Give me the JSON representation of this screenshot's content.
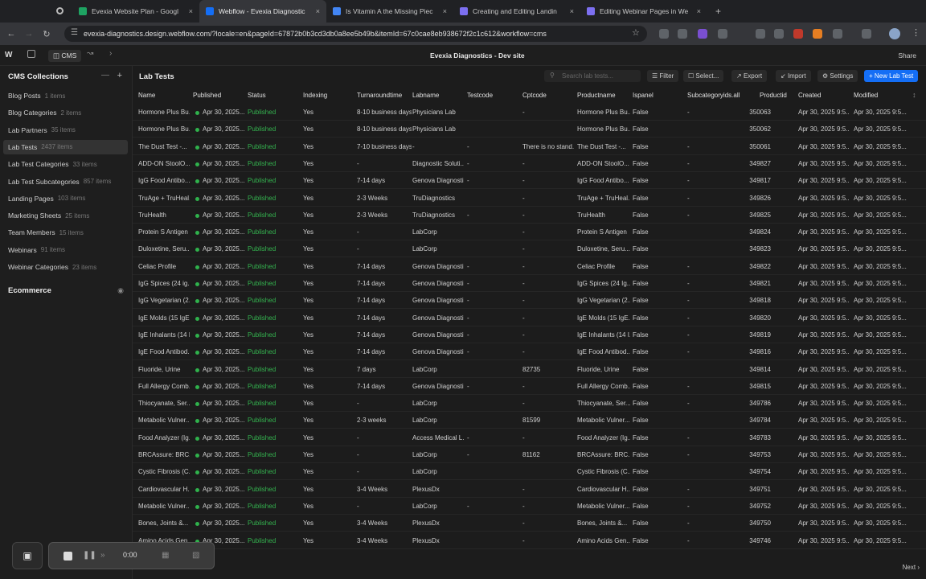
{
  "browser": {
    "tabs": [
      {
        "title": "Evexia Website Plan - Googl",
        "color": "#1ea362",
        "active": false
      },
      {
        "title": "Webflow - Evexia Diagnostic",
        "color": "#146ef5",
        "active": true
      },
      {
        "title": "Is Vitamin A the Missing Piec",
        "color": "#4285f4",
        "active": false
      },
      {
        "title": "Creating and Editing Landin",
        "color": "#7c6ff0",
        "active": false
      },
      {
        "title": "Editing Webinar Pages in We",
        "color": "#7c6ff0",
        "active": false
      }
    ],
    "new_tab": "+",
    "url": "evexia-diagnostics.design.webflow.com/?locale=en&pageId=67872b0b3cd3db0a8ee5b49b&itemId=67c0cae8eb938672f2c1c612&workflow=cms"
  },
  "webflow": {
    "cms_label": "CMS",
    "site_title": "Evexia Diagnostics - Dev site",
    "share_label": "Share"
  },
  "sidebar": {
    "heading": "CMS Collections",
    "collections": [
      {
        "name": "Blog Posts",
        "count": "1 items"
      },
      {
        "name": "Blog Categories",
        "count": "2 items"
      },
      {
        "name": "Lab Partners",
        "count": "35 items"
      },
      {
        "name": "Lab Tests",
        "count": "2437 items"
      },
      {
        "name": "Lab Test Categories",
        "count": "33 items"
      },
      {
        "name": "Lab Test Subcategories",
        "count": "857 items"
      },
      {
        "name": "Landing Pages",
        "count": "103 items"
      },
      {
        "name": "Marketing Sheets",
        "count": "25 items"
      },
      {
        "name": "Team Members",
        "count": "15 items"
      },
      {
        "name": "Webinars",
        "count": "91 items"
      },
      {
        "name": "Webinar Categories",
        "count": "23 items"
      }
    ],
    "selected": "Lab Tests",
    "ecommerce": "Ecommerce"
  },
  "main": {
    "title": "Lab Tests",
    "search_placeholder": "Search lab tests...",
    "buttons": {
      "filter": "Filter",
      "select": "Select...",
      "export": "Export",
      "import": "Import",
      "settings": "Settings",
      "new": "+ New Lab Test"
    },
    "columns": [
      "Name",
      "Published",
      "Status",
      "Indexing",
      "Turnaroundtime",
      "Labname",
      "Testcode",
      "Cptcode",
      "Productname",
      "Ispanel",
      "Subcategoryids.all",
      "Productid",
      "Created",
      "Modified"
    ],
    "rows": [
      [
        "Hormone Plus Bu...",
        "Apr 30, 2025...",
        "Published",
        "Yes",
        "8-10 business days",
        "Physicians Lab",
        "",
        "-",
        "Hormone Plus Bu...",
        "False",
        "-",
        "350063",
        "Apr 30, 2025 9:5...",
        "Apr 30, 2025 9:5..."
      ],
      [
        "Hormone Plus Bu...",
        "Apr 30, 2025...",
        "Published",
        "Yes",
        "8-10 business days",
        "Physicians Lab",
        "",
        "",
        "Hormone Plus Bu...",
        "False",
        "",
        "350062",
        "Apr 30, 2025 9:5...",
        "Apr 30, 2025 9:5..."
      ],
      [
        "The Dust Test -...",
        "Apr 30, 2025...",
        "Published",
        "Yes",
        "7-10 business days",
        "-",
        "-",
        "There is no stand...",
        "The Dust Test -...",
        "False",
        "-",
        "350061",
        "Apr 30, 2025 9:5...",
        "Apr 30, 2025 9:5..."
      ],
      [
        "ADD-ON StoolO...",
        "Apr 30, 2025...",
        "Published",
        "Yes",
        "-",
        "Diagnostic Soluti...",
        "-",
        "-",
        "ADD-ON StoolO...",
        "False",
        "-",
        "349827",
        "Apr 30, 2025 9:5...",
        "Apr 30, 2025 9:5..."
      ],
      [
        "IgG Food Antibo...",
        "Apr 30, 2025...",
        "Published",
        "Yes",
        "7-14 days",
        "Genova Diagnosti...",
        "-",
        "-",
        "IgG Food Antibo...",
        "False",
        "-",
        "349817",
        "Apr 30, 2025 9:5...",
        "Apr 30, 2025 9:5..."
      ],
      [
        "TruAge + TruHeal...",
        "Apr 30, 2025...",
        "Published",
        "Yes",
        "2-3 Weeks",
        "TruDiagnostics",
        "",
        "-",
        "TruAge + TruHeal...",
        "False",
        "-",
        "349826",
        "Apr 30, 2025 9:5...",
        "Apr 30, 2025 9:5..."
      ],
      [
        "TruHealth",
        "Apr 30, 2025...",
        "Published",
        "Yes",
        "2-3 Weeks",
        "TruDiagnostics",
        "-",
        "-",
        "TruHealth",
        "False",
        "-",
        "349825",
        "Apr 30, 2025 9:5...",
        "Apr 30, 2025 9:5..."
      ],
      [
        "Protein S Antigen",
        "Apr 30, 2025...",
        "Published",
        "Yes",
        "-",
        "LabCorp",
        "",
        "-",
        "Protein S Antigen",
        "False",
        "",
        "349824",
        "Apr 30, 2025 9:5...",
        "Apr 30, 2025 9:5..."
      ],
      [
        "Duloxetine, Seru...",
        "Apr 30, 2025...",
        "Published",
        "Yes",
        "-",
        "LabCorp",
        "",
        "-",
        "Duloxetine, Seru...",
        "False",
        "",
        "349823",
        "Apr 30, 2025 9:5...",
        "Apr 30, 2025 9:5..."
      ],
      [
        "Celiac Profile",
        "Apr 30, 2025...",
        "Published",
        "Yes",
        "7-14 days",
        "Genova Diagnosti...",
        "-",
        "-",
        "Celiac Profile",
        "False",
        "-",
        "349822",
        "Apr 30, 2025 9:5...",
        "Apr 30, 2025 9:5..."
      ],
      [
        "IgG Spices (24 ig...",
        "Apr 30, 2025...",
        "Published",
        "Yes",
        "7-14 days",
        "Genova Diagnosti...",
        "-",
        "-",
        "IgG Spices (24 Ig...",
        "False",
        "-",
        "349821",
        "Apr 30, 2025 9:5...",
        "Apr 30, 2025 9:5..."
      ],
      [
        "IgG Vegetarian (2...",
        "Apr 30, 2025...",
        "Published",
        "Yes",
        "7-14 days",
        "Genova Diagnosti...",
        "-",
        "-",
        "IgG Vegetarian (2...",
        "False",
        "-",
        "349818",
        "Apr 30, 2025 9:5...",
        "Apr 30, 2025 9:5..."
      ],
      [
        "IgE Molds (15 IgE...",
        "Apr 30, 2025...",
        "Published",
        "Yes",
        "7-14 days",
        "Genova Diagnosti...",
        "-",
        "-",
        "IgE Molds (15 IgE...",
        "False",
        "-",
        "349820",
        "Apr 30, 2025 9:5...",
        "Apr 30, 2025 9:5..."
      ],
      [
        "IgE Inhalants (14 I...",
        "Apr 30, 2025...",
        "Published",
        "Yes",
        "7-14 days",
        "Genova Diagnosti...",
        "-",
        "-",
        "IgE Inhalants (14 I...",
        "False",
        "-",
        "349819",
        "Apr 30, 2025 9:5...",
        "Apr 30, 2025 9:5..."
      ],
      [
        "IgE Food Antibod...",
        "Apr 30, 2025...",
        "Published",
        "Yes",
        "7-14 days",
        "Genova Diagnosti...",
        "-",
        "-",
        "IgE Food Antibod...",
        "False",
        "-",
        "349816",
        "Apr 30, 2025 9:5...",
        "Apr 30, 2025 9:5..."
      ],
      [
        "Fluoride, Urine",
        "Apr 30, 2025...",
        "Published",
        "Yes",
        "7 days",
        "LabCorp",
        "",
        "82735",
        "Fluoride, Urine",
        "False",
        "",
        "349814",
        "Apr 30, 2025 9:5...",
        "Apr 30, 2025 9:5..."
      ],
      [
        "Full Allergy Comb...",
        "Apr 30, 2025...",
        "Published",
        "Yes",
        "7-14 days",
        "Genova Diagnosti...",
        "-",
        "-",
        "Full Allergy Comb...",
        "False",
        "-",
        "349815",
        "Apr 30, 2025 9:5...",
        "Apr 30, 2025 9:5..."
      ],
      [
        "Thiocyanate, Ser...",
        "Apr 30, 2025...",
        "Published",
        "Yes",
        "-",
        "LabCorp",
        "",
        "-",
        "Thiocyanate, Ser...",
        "False",
        "-",
        "349786",
        "Apr 30, 2025 9:5...",
        "Apr 30, 2025 9:5..."
      ],
      [
        "Metabolic Vulner...",
        "Apr 30, 2025...",
        "Published",
        "Yes",
        "2-3 weeks",
        "LabCorp",
        "",
        "81599",
        "Metabolic Vulner...",
        "False",
        "",
        "349784",
        "Apr 30, 2025 9:5...",
        "Apr 30, 2025 9:5..."
      ],
      [
        "Food Analyzer (Ig...",
        "Apr 30, 2025...",
        "Published",
        "Yes",
        "-",
        "Access Medical L...",
        "-",
        "-",
        "Food Analyzer (Ig...",
        "False",
        "-",
        "349783",
        "Apr 30, 2025 9:5...",
        "Apr 30, 2025 9:5..."
      ],
      [
        "BRCAssure: BRC...",
        "Apr 30, 2025...",
        "Published",
        "Yes",
        "-",
        "LabCorp",
        "-",
        "81162",
        "BRCAssure: BRC...",
        "False",
        "-",
        "349753",
        "Apr 30, 2025 9:5...",
        "Apr 30, 2025 9:5..."
      ],
      [
        "Cystic Fibrosis (C...",
        "Apr 30, 2025...",
        "Published",
        "Yes",
        "-",
        "LabCorp",
        "",
        "",
        "Cystic Fibrosis (C...",
        "False",
        "",
        "349754",
        "Apr 30, 2025 9:5...",
        "Apr 30, 2025 9:5..."
      ],
      [
        "Cardiovascular H...",
        "Apr 30, 2025...",
        "Published",
        "Yes",
        "3-4 Weeks",
        "PlexusDx",
        "",
        "-",
        "Cardiovascular H...",
        "False",
        "-",
        "349751",
        "Apr 30, 2025 9:5...",
        "Apr 30, 2025 9:5..."
      ],
      [
        "Metabolic Vulner...",
        "Apr 30, 2025...",
        "Published",
        "Yes",
        "-",
        "LabCorp",
        "-",
        "-",
        "Metabolic Vulner...",
        "False",
        "-",
        "349752",
        "Apr 30, 2025 9:5...",
        "Apr 30, 2025 9:5..."
      ],
      [
        "Bones, Joints &...",
        "Apr 30, 2025...",
        "Published",
        "Yes",
        "3-4 Weeks",
        "PlexusDx",
        "",
        "-",
        "Bones, Joints &...",
        "False",
        "-",
        "349750",
        "Apr 30, 2025 9:5...",
        "Apr 30, 2025 9:5..."
      ],
      [
        "Amino Acids Gen...",
        "Apr 30, 2025...",
        "Published",
        "Yes",
        "3-4 Weeks",
        "PlexusDx",
        "",
        "-",
        "Amino Acids Gen...",
        "False",
        "-",
        "349746",
        "Apr 30, 2025 9:5...",
        "Apr 30, 2025 9:5..."
      ]
    ],
    "next_label": "Next"
  },
  "recorder": {
    "time": "0:00"
  }
}
